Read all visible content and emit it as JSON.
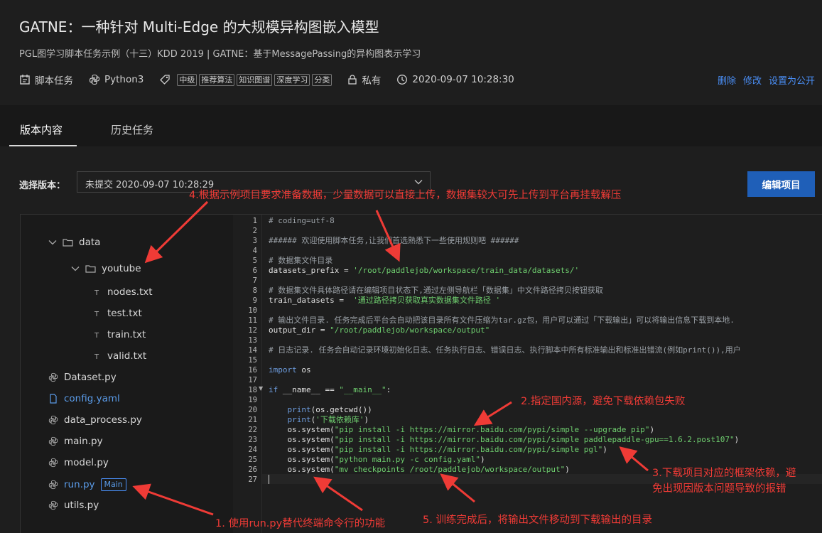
{
  "header": {
    "title": "GATNE：一种针对 Multi-Edge 的大规模异构图嵌入模型",
    "subtitle": "PGL图学习脚本任务示例（十三）KDD 2019 | GATNE：基于MessagePassing的异构图表示学习",
    "meta": {
      "task_type": "脚本任务",
      "language": "Python3",
      "tags": [
        "中级",
        "推荐算法",
        "知识图谱",
        "深度学习",
        "分类"
      ],
      "visibility": "私有",
      "datetime": "2020-09-07 10:28:30"
    },
    "actions": {
      "delete": "删除",
      "modify": "修改",
      "set_public": "设置为公开"
    }
  },
  "tabs": {
    "content": "版本内容",
    "history": "历史任务"
  },
  "version": {
    "label": "选择版本：",
    "selected": "未提交 2020-09-07 10:28:29",
    "edit_button": "编辑项目"
  },
  "file_tree": {
    "data_folder": "data",
    "youtube_folder": "youtube",
    "youtube_files": [
      "nodes.txt",
      "test.txt",
      "train.txt",
      "valid.txt"
    ],
    "files": [
      "Dataset.py",
      "config.yaml",
      "data_process.py",
      "main.py",
      "model.py",
      "run.py",
      "utils.py"
    ],
    "main_badge": "Main"
  },
  "code": {
    "line_numbers": [
      "1",
      "2",
      "3",
      "4",
      "5",
      "6",
      "7",
      "8",
      "9",
      "10",
      "11",
      "12",
      "13",
      "14",
      "15",
      "16",
      "17",
      "18",
      "19",
      "20",
      "21",
      "22",
      "23",
      "24",
      "25",
      "26",
      "27"
    ],
    "l1": "# coding=utf-8",
    "l3": "###### 欢迎使用脚本任务,让我们首选熟悉下一些使用规则吧 ######",
    "l5": "# 数据集文件目录",
    "l6a": "datasets_prefix = ",
    "l6b": "'/root/paddlejob/workspace/train_data/datasets/'",
    "l8": "# 数据集文件具体路径请在编辑项目状态下,通过左侧导航栏「数据集」中文件路径拷贝按钮获取",
    "l9a": "train_datasets =  ",
    "l9b": "'通过路径拷贝获取真实数据集文件路径 '",
    "l11": "# 输出文件目录. 任务完成后平台会自动把该目录所有文件压缩为tar.gz包，用户可以通过「下载输出」可以将输出信息下载到本地.",
    "l12a": "output_dir = ",
    "l12b": "\"/root/paddlejob/workspace/output\"",
    "l14": "# 日志记录. 任务会自动记录环境初始化日志、任务执行日志、错误日志、执行脚本中所有标准输出和标准出错流(例如print()),用户",
    "l16a": "import",
    "l16b": " os",
    "l18a": "if",
    "l18b": " __name__ == ",
    "l18c": "\"__main__\"",
    "l18d": ":",
    "l20a": "    print",
    "l20b": "(os.getcwd())",
    "l21a": "    print",
    "l21b": "(",
    "l21c": "'下载依赖库'",
    "l21d": ")",
    "l22a": "    os.system(",
    "l22b": "\"pip install -i https://mirror.baidu.com/pypi/simple --upgrade pip\"",
    "l22c": ")",
    "l23a": "    os.system(",
    "l23b": "\"pip install -i https://mirror.baidu.com/pypi/simple paddlepaddle-gpu==1.6.2.post107\"",
    "l23c": ")",
    "l24a": "    os.system(",
    "l24b": "\"pip install -i https://mirror.baidu.com/pypi/simple pgl\"",
    "l24c": ")",
    "l25a": "    os.system(",
    "l25b": "\"python main.py -c config.yaml\"",
    "l25c": ")",
    "l26a": "    os.system(",
    "l26b": "\"mv checkpoints /root/paddlejob/workspace/output\"",
    "l26c": ")"
  },
  "annotations": {
    "a4": "4.根据示例项目要求准备数据，少量数据可以直接上传，数据集较大可先上传到平台再挂载解压",
    "a2": "2.指定国内源，避免下载依赖包失败",
    "a3_line1": "3.下载项目对应的框架依赖，避",
    "a3_line2": "免出现因版本问题导致的报错",
    "a1": "1. 使用run.py替代终端命令行的功能",
    "a5": "5. 训练完成后，将输出文件移动到下载输出的目录"
  },
  "colors": {
    "accent": "#4a8ff7",
    "annotation": "#ef3b36",
    "button": "#1f5fb8"
  }
}
